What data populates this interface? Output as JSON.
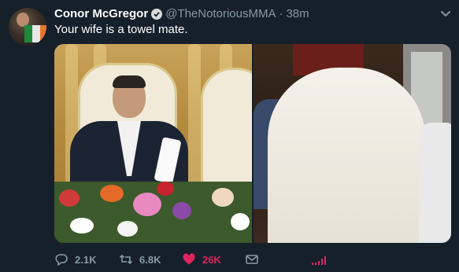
{
  "tweet": {
    "author_name": "Conor McGregor",
    "handle": "@TheNotoriousMMA",
    "separator": "·",
    "time": "38m",
    "text": "Your wife is a towel mate.",
    "verified": true
  },
  "actions": {
    "replies": "2.1K",
    "retweets": "6.8K",
    "likes": "26K",
    "reply_icon": "reply-icon",
    "retweet_icon": "retweet-icon",
    "like_icon": "heart-icon",
    "dm_icon": "envelope-icon",
    "analytics_icon": "analytics-icon"
  },
  "colors": {
    "background": "#15202b",
    "secondary_text": "#8899a6",
    "like": "#e0245e",
    "analytics": "#e0245e"
  },
  "media": {
    "photo_count": 2
  }
}
